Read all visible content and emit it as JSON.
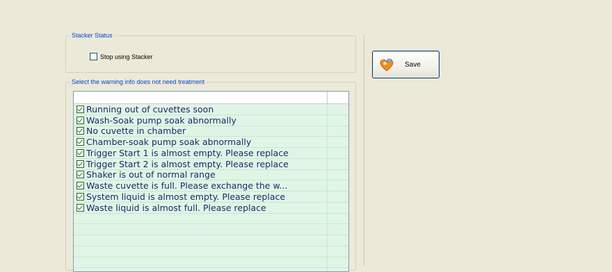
{
  "stacker": {
    "group_title": "Stacker Status",
    "stop_label": "Stop using Stacker",
    "stop_checked": false
  },
  "warnings": {
    "group_title": "Select the warning info does not need treatment",
    "items": [
      {
        "label": "Running out of cuvettes soon",
        "checked": true
      },
      {
        "label": "Wash-Soak pump soak abnormally",
        "checked": true
      },
      {
        "label": "No cuvette in chamber",
        "checked": true
      },
      {
        "label": "Chamber-soak pump soak abnormally",
        "checked": true
      },
      {
        "label": "Trigger Start 1 is almost empty. Please replace",
        "checked": true
      },
      {
        "label": "Trigger Start 2 is almost empty. Please replace",
        "checked": true
      },
      {
        "label": "Shaker is out of normal range",
        "checked": true
      },
      {
        "label": "Waste cuvette is full. Please exchange the w...",
        "checked": true
      },
      {
        "label": "System liquid is almost empty. Please replace",
        "checked": true
      },
      {
        "label": "Waste liquid is almost full. Please replace",
        "checked": true
      }
    ]
  },
  "toolbar": {
    "save_label": "Save",
    "save_icon": "heart-save-icon"
  },
  "colors": {
    "window_bg": "#ece9d8",
    "list_bg": "#e0f5e6",
    "group_title": "#0046d5",
    "item_text": "#1a2a6c"
  }
}
